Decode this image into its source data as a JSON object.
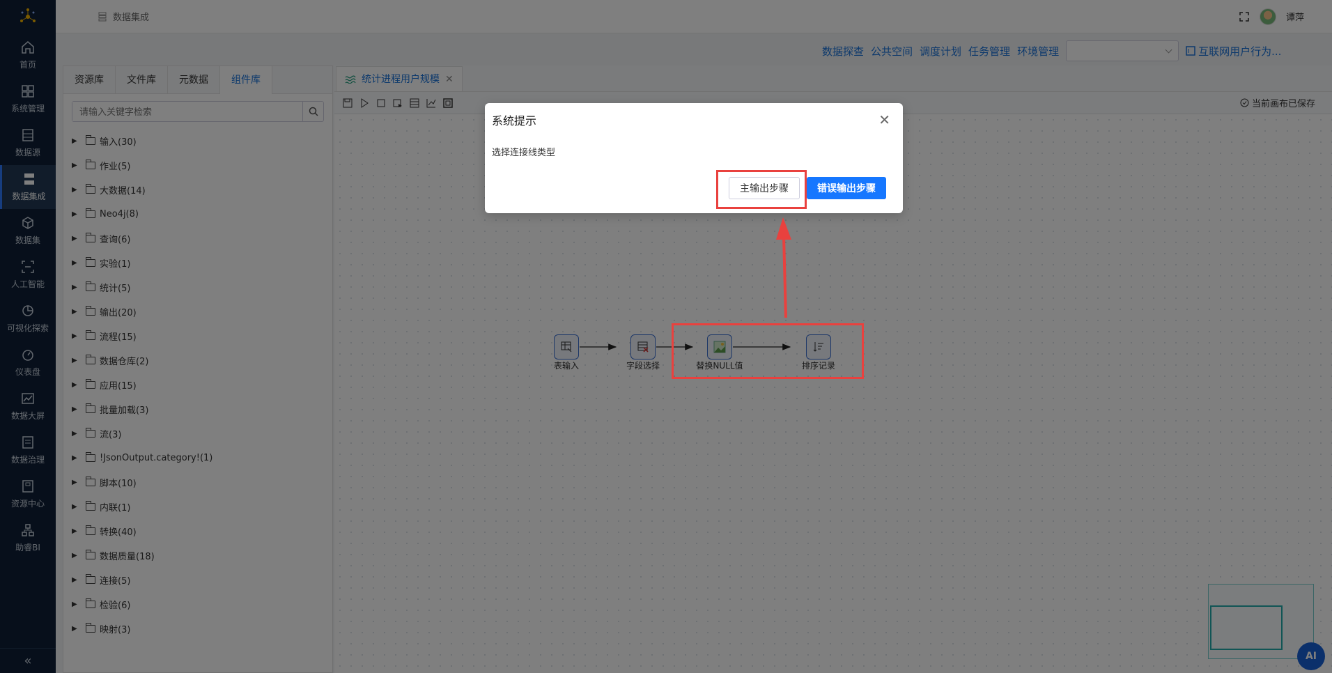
{
  "sidebar": {
    "items": [
      {
        "label": "首页",
        "icon": "home-icon"
      },
      {
        "label": "系统管理",
        "icon": "grid-icon"
      },
      {
        "label": "数据源",
        "icon": "database-icon"
      },
      {
        "label": "数据集成",
        "icon": "server-icon"
      },
      {
        "label": "数据集",
        "icon": "cube-icon"
      },
      {
        "label": "人工智能",
        "icon": "scan-icon"
      },
      {
        "label": "可视化探索",
        "icon": "pie-chart-icon"
      },
      {
        "label": "仪表盘",
        "icon": "gauge-icon"
      },
      {
        "label": "数据大屏",
        "icon": "line-chart-icon"
      },
      {
        "label": "数据治理",
        "icon": "document-icon"
      },
      {
        "label": "资源中心",
        "icon": "archive-icon"
      },
      {
        "label": "助睿BI",
        "icon": "org-chart-icon"
      }
    ],
    "active_index": 3
  },
  "header": {
    "breadcrumb": "数据集成",
    "user_name": "谭萍"
  },
  "top_links": [
    "数据探查",
    "公共空间",
    "调度计划",
    "任务管理",
    "环境管理"
  ],
  "top_select_value": "",
  "top_project_link": "互联网用户行为...",
  "panel": {
    "tabs": [
      "资源库",
      "文件库",
      "元数据",
      "组件库"
    ],
    "active_tab": 3,
    "search_placeholder": "请输入关键字检索",
    "tree": [
      "输入(30)",
      "作业(5)",
      "大数据(14)",
      "Neo4j(8)",
      "查询(6)",
      "实验(1)",
      "统计(5)",
      "输出(20)",
      "流程(15)",
      "数据仓库(2)",
      "应用(15)",
      "批量加载(3)",
      "流(3)",
      "!JsonOutput.category!(1)",
      "脚本(10)",
      "内联(1)",
      "转换(40)",
      "数据质量(18)",
      "连接(5)",
      "检验(6)",
      "映射(3)"
    ]
  },
  "canvas": {
    "tab_label": "统计进程用户规模",
    "save_status": "当前画布已保存",
    "nodes": [
      {
        "label": "表输入",
        "icon": "table-input-icon"
      },
      {
        "label": "字段选择",
        "icon": "field-select-icon"
      },
      {
        "label": "替换NULL值",
        "icon": "replace-null-icon"
      },
      {
        "label": "排序记录",
        "icon": "sort-icon"
      }
    ]
  },
  "ai_button": "AI",
  "modal": {
    "title": "系统提示",
    "message": "选择连接线类型",
    "main_button": "主输出步骤",
    "error_button": "错误输出步骤"
  },
  "colors": {
    "nav_bg": "#0f1f36",
    "accent": "#1677ff",
    "link": "#1a73d9",
    "highlight": "#e9413e"
  }
}
